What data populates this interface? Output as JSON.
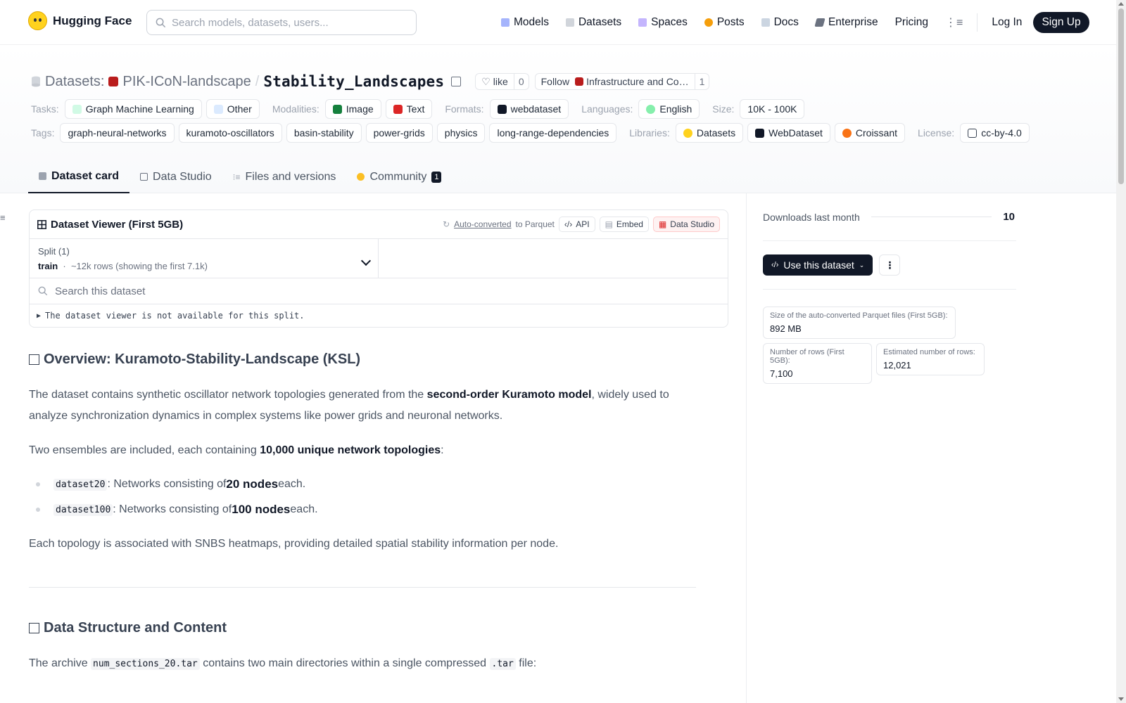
{
  "nav": {
    "brand": "Hugging Face",
    "search_placeholder": "Search models, datasets, users...",
    "links": [
      "Models",
      "Datasets",
      "Spaces",
      "Posts",
      "Docs",
      "Enterprise",
      "Pricing"
    ],
    "login": "Log In",
    "signup": "Sign Up"
  },
  "header": {
    "section": "Datasets:",
    "org": "PIK-ICoN-landscape",
    "separator": "/",
    "name": "Stability_Landscapes",
    "like": "like",
    "like_count": "0",
    "follow": "Follow",
    "follow_target": "Infrastructure and Co…",
    "follow_count": "1"
  },
  "meta": {
    "tasks_label": "Tasks:",
    "tasks": [
      "Graph Machine Learning",
      "Other"
    ],
    "modalities_label": "Modalities:",
    "modalities": [
      "Image",
      "Text"
    ],
    "formats_label": "Formats:",
    "formats": [
      "webdataset"
    ],
    "languages_label": "Languages:",
    "languages": [
      "English"
    ],
    "size_label": "Size:",
    "size": "10K - 100K",
    "tags_label": "Tags:",
    "tags": [
      "graph-neural-networks",
      "kuramoto-oscillators",
      "basin-stability",
      "power-grids",
      "physics",
      "long-range-dependencies"
    ],
    "libraries_label": "Libraries:",
    "libraries": [
      "Datasets",
      "WebDataset",
      "Croissant"
    ],
    "license_label": "License:",
    "license": "cc-by-4.0"
  },
  "tabs": [
    "Dataset card",
    "Data Studio",
    "Files and versions",
    "Community"
  ],
  "community_count": "1",
  "viewer": {
    "title": "Dataset Viewer (First 5GB)",
    "auto": "Auto-converted",
    "to_parquet": "to Parquet",
    "api": "API",
    "embed": "Embed",
    "studio": "Data Studio",
    "split_label": "Split (1)",
    "split_name": "train",
    "split_rows": "~12k rows (showing the first 7.1k)",
    "search_placeholder": "Search this dataset",
    "note": "The dataset viewer is not available for this split."
  },
  "card": {
    "h_overview": "Overview: Kuramoto-Stability-Landscape (KSL)",
    "p1_a": "The dataset contains synthetic oscillator network topologies generated from the ",
    "p1_b": "second-order Kuramoto model",
    "p1_c": ", widely used to analyze synchronization dynamics in complex systems like power grids and neuronal networks.",
    "p2_a": "Two ensembles are included, each containing ",
    "p2_b": "10,000 unique network topologies",
    "p2_c": ":",
    "li1_code": "dataset20",
    "li1_a": ": Networks consisting of ",
    "li1_b": "20 nodes",
    "li1_c": " each.",
    "li2_code": "dataset100",
    "li2_a": ": Networks consisting of ",
    "li2_b": "100 nodes",
    "li2_c": " each.",
    "p3": "Each topology is associated with SNBS heatmaps, providing detailed spatial stability information per node.",
    "h_structure": "Data Structure and Content",
    "p4_a": "The archive ",
    "p4_code": "num_sections_20.tar",
    "p4_b": " contains two main directories within a single compressed ",
    "p4_code2": ".tar",
    "p4_c": " file:"
  },
  "side": {
    "downloads_label": "Downloads last month",
    "downloads": "10",
    "use_btn": "Use this dataset",
    "parquet_size_label": "Size of the auto-converted Parquet files (First 5GB):",
    "parquet_size": "892 MB",
    "rows_label": "Number of rows (First 5GB):",
    "rows": "7,100",
    "est_rows_label": "Estimated number of rows:",
    "est_rows": "12,021"
  }
}
